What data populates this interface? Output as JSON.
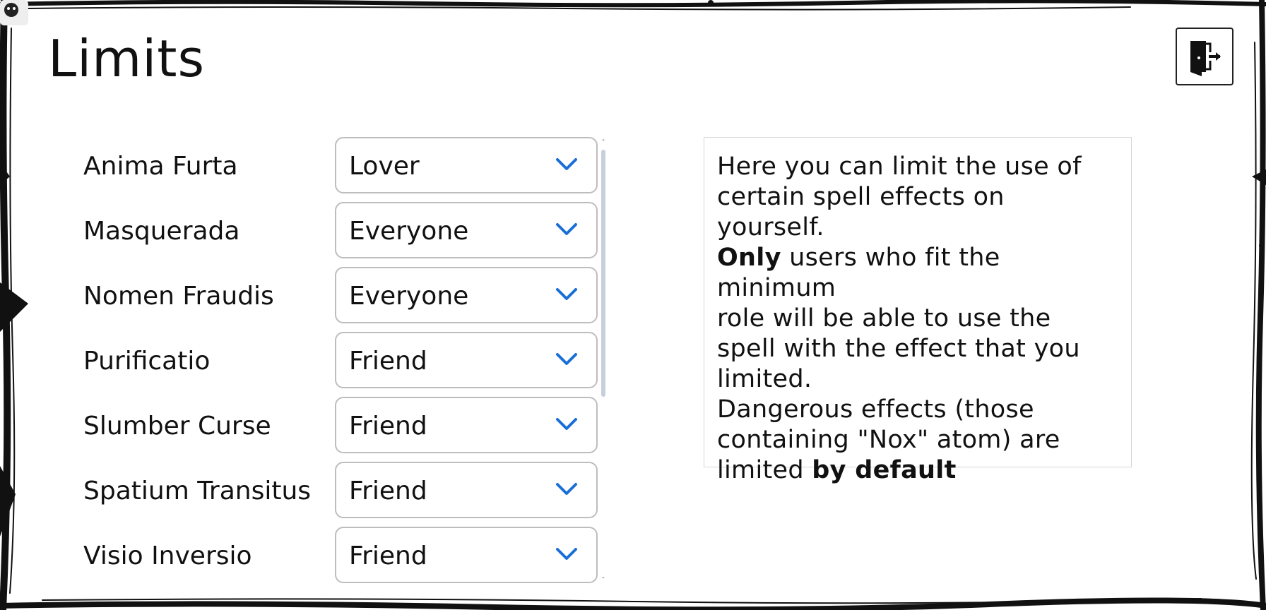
{
  "page": {
    "title": "Limits"
  },
  "exit_button": {
    "icon": "door-exit-icon"
  },
  "settings": [
    {
      "label": "Anima Furta",
      "value": "Lover"
    },
    {
      "label": "Masquerada",
      "value": "Everyone"
    },
    {
      "label": "Nomen Fraudis",
      "value": "Everyone"
    },
    {
      "label": "Purificatio",
      "value": "Friend"
    },
    {
      "label": "Slumber Curse",
      "value": "Friend"
    },
    {
      "label": "Spatium Transitus",
      "value": "Friend"
    },
    {
      "label": "Visio Inversio",
      "value": "Friend"
    }
  ],
  "info": {
    "line1": "Here you can limit the use of",
    "line2": "certain spell effects on",
    "line3": "yourself.",
    "line4_bold": "Only",
    "line4_rest": " users who fit the minimum",
    "line5": "role will be able to use the",
    "line6": "spell with the effect that you",
    "line7": "limited.",
    "line8": "Dangerous effects (those",
    "line9": "containing \"Nox\" atom) are",
    "line10_start": "limited ",
    "line10_bold": "by default"
  },
  "colors": {
    "accent_chevron": "#1a6fd6",
    "border": "#bdbdbd",
    "scroll_thumb": "#c7cfdc"
  }
}
